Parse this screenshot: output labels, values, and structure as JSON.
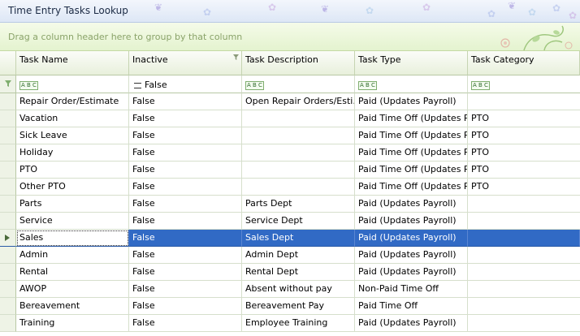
{
  "window": {
    "title": "Time Entry Tasks Lookup"
  },
  "group_panel": {
    "hint": "Drag a column header here to group by that column"
  },
  "columns": [
    "Task Name",
    "Inactive",
    "Task Description",
    "Task Type",
    "Task Category"
  ],
  "filter_row": {
    "inactive": "False"
  },
  "rows": [
    [
      "Repair Order/Estimate",
      "False",
      "Open Repair Orders/Esti...",
      "Paid (Updates Payroll)",
      ""
    ],
    [
      "Vacation",
      "False",
      "",
      "Paid Time Off (Updates P...",
      "PTO"
    ],
    [
      "Sick Leave",
      "False",
      "",
      "Paid Time Off (Updates P...",
      "PTO"
    ],
    [
      "Holiday",
      "False",
      "",
      "Paid Time Off (Updates P...",
      "PTO"
    ],
    [
      "PTO",
      "False",
      "",
      "Paid Time Off (Updates P...",
      "PTO"
    ],
    [
      "Other PTO",
      "False",
      "",
      "Paid Time Off (Updates P...",
      "PTO"
    ],
    [
      "Parts",
      "False",
      "Parts Dept",
      "Paid (Updates Payroll)",
      ""
    ],
    [
      "Service",
      "False",
      "Service Dept",
      "Paid (Updates Payroll)",
      ""
    ],
    [
      "Sales",
      "False",
      "Sales Dept",
      "Paid (Updates Payroll)",
      ""
    ],
    [
      "Admin",
      "False",
      "Admin Dept",
      "Paid (Updates Payroll)",
      ""
    ],
    [
      "Rental",
      "False",
      "Rental Dept",
      "Paid (Updates Payroll)",
      ""
    ],
    [
      "AWOP",
      "False",
      "Absent without pay",
      "Non-Paid Time Off",
      ""
    ],
    [
      "Bereavement",
      "False",
      "Bereavement Pay",
      "Paid Time Off",
      ""
    ],
    [
      "Training",
      "False",
      "Employee Training",
      "Paid (Updates Payroll)",
      ""
    ]
  ],
  "selected_row": 8,
  "colors": {
    "selection": "#316ac5",
    "group_panel": "#e4f3cf",
    "title_bar": "#dde7f6"
  }
}
